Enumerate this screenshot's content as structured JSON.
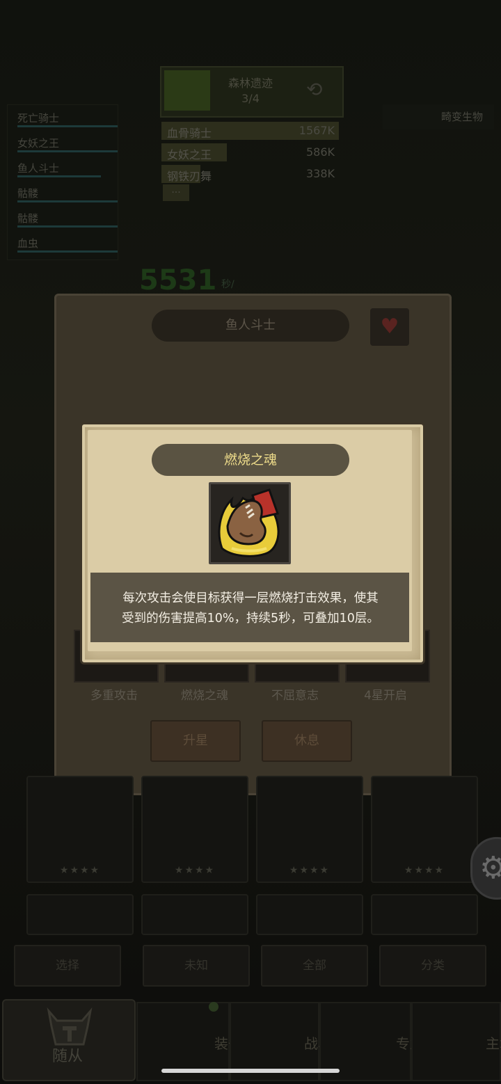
{
  "boss": {
    "name": "森林遗迹",
    "count": "3/4"
  },
  "damage_rank": [
    {
      "name": "血骨骑士",
      "value": "1567K",
      "fill": 1.0
    },
    {
      "name": "女妖之王",
      "value": "586K",
      "fill": 0.37
    },
    {
      "name": "钢铁刃舞",
      "value": "338K",
      "fill": 0.22
    }
  ],
  "damage_more": "...",
  "followers_list": [
    "死亡骑士",
    "女妖之王",
    "鱼人斗士",
    "骷髅",
    "骷髅",
    "血虫"
  ],
  "mutant_label": "畸变生物",
  "speed": {
    "value": "5531",
    "unit": "秒/"
  },
  "panel": {
    "title": "鱼人斗士",
    "skills": [
      "多重攻击",
      "燃烧之魂",
      "不屈意志",
      "4星开启"
    ],
    "upgrade_button": "升星",
    "rest_button": "休息"
  },
  "roster": {
    "stars": "★★★★"
  },
  "tabs": [
    "选择",
    "未知",
    "全部",
    "分类"
  ],
  "nav": {
    "home": "随从",
    "equip": "装备",
    "battle": "战斗",
    "profession": "专业",
    "city": "主城"
  },
  "popup": {
    "title": "燃烧之魂",
    "description_line1": "每次攻击会使目标获得一层燃烧打击效果，使其",
    "description_line2": "受到的伤害提高10%，持续5秒，可叠加10层。",
    "icon": "burning-fist-icon"
  },
  "colors": {
    "popup_title": "#eddb8a",
    "popup_bg": "#dbcca6",
    "desc_bg": "#5b5445"
  }
}
